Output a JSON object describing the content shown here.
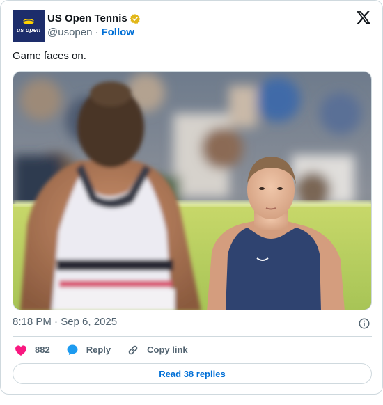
{
  "tweet": {
    "author": {
      "display_name": "US Open Tennis",
      "handle": "@usopen",
      "verified_badge": "gold-verified-icon",
      "avatar_text": "us open",
      "avatar_colors": {
        "background": "#1d2d6b",
        "ball": "#ffd200",
        "text": "#ffffff"
      }
    },
    "follow_label": "Follow",
    "separator": "·",
    "text": "Game faces on.",
    "timestamp": "8:18 PM · Sep 6, 2025",
    "actions": {
      "like_count": "882",
      "reply_label": "Reply",
      "copy_link_label": "Copy link"
    },
    "read_replies_label": "Read 38 replies"
  },
  "colors": {
    "text_primary": "#0f1419",
    "text_secondary": "#536471",
    "link": "#006fd6",
    "border": "#cfd9de",
    "like": "#f91880",
    "reply": "#1d9bf0",
    "verified_gold": "#e2b719"
  },
  "icons": {
    "platform": "x-logo-icon",
    "info": "info-icon",
    "like": "heart-icon",
    "reply": "speech-bubble-icon",
    "copy_link": "link-icon"
  }
}
